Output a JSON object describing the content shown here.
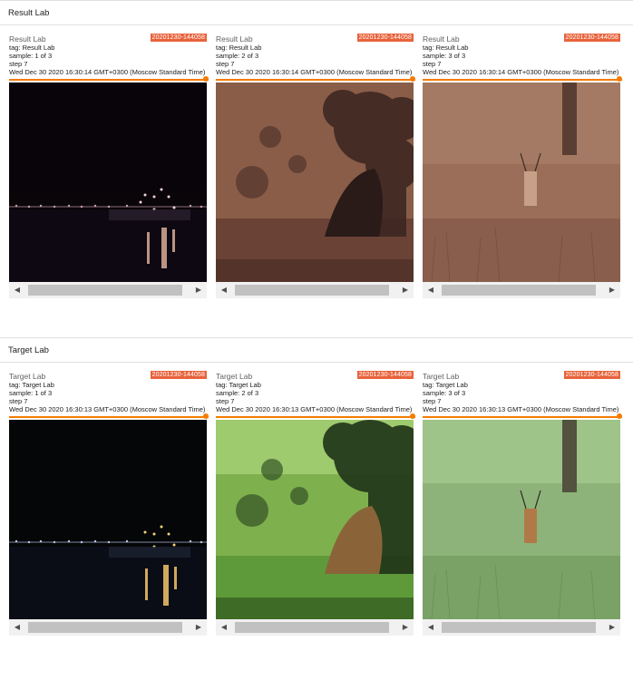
{
  "sections": [
    {
      "title": "Result Lab",
      "cards": [
        {
          "title": "Result Lab",
          "run": "20201230-144058",
          "tag": "tag: Result Lab",
          "sample": "sample: 1 of 3",
          "step": "step 7",
          "time": "Wed Dec 30 2020 16:30:14 GMT+0300 (Moscow Standard Time)",
          "slider_value": 1.0
        },
        {
          "title": "Result Lab",
          "run": "20201230-144058",
          "tag": "tag: Result Lab",
          "sample": "sample: 2 of 3",
          "step": "step 7",
          "time": "Wed Dec 30 2020 16:30:14 GMT+0300 (Moscow Standard Time)",
          "slider_value": 1.0
        },
        {
          "title": "Result Lab",
          "run": "20201230-144058",
          "tag": "tag: Result Lab",
          "sample": "sample: 3 of 3",
          "step": "step 7",
          "time": "Wed Dec 30 2020 16:30:14 GMT+0300 (Moscow Standard Time)",
          "slider_value": 1.0
        }
      ]
    },
    {
      "title": "Target Lab",
      "cards": [
        {
          "title": "Target Lab",
          "run": "20201230-144058",
          "tag": "tag: Target Lab",
          "sample": "sample: 1 of 3",
          "step": "step 7",
          "time": "Wed Dec 30 2020 16:30:13 GMT+0300 (Moscow Standard Time)",
          "slider_value": 1.0
        },
        {
          "title": "Target Lab",
          "run": "20201230-144058",
          "tag": "tag: Target Lab",
          "sample": "sample: 2 of 3",
          "step": "step 7",
          "time": "Wed Dec 30 2020 16:30:13 GMT+0300 (Moscow Standard Time)",
          "slider_value": 1.0
        },
        {
          "title": "Target Lab",
          "run": "20201230-144058",
          "tag": "tag: Target Lab",
          "sample": "sample: 3 of 3",
          "step": "step 7",
          "time": "Wed Dec 30 2020 16:30:13 GMT+0300 (Moscow Standard Time)",
          "slider_value": 1.0
        }
      ]
    }
  ],
  "icons": {
    "scroll_left": "scroll-left-arrow-icon",
    "scroll_right": "scroll-right-arrow-icon"
  },
  "colors": {
    "accent": "#f57c00",
    "run_badge": "#e8633c"
  }
}
